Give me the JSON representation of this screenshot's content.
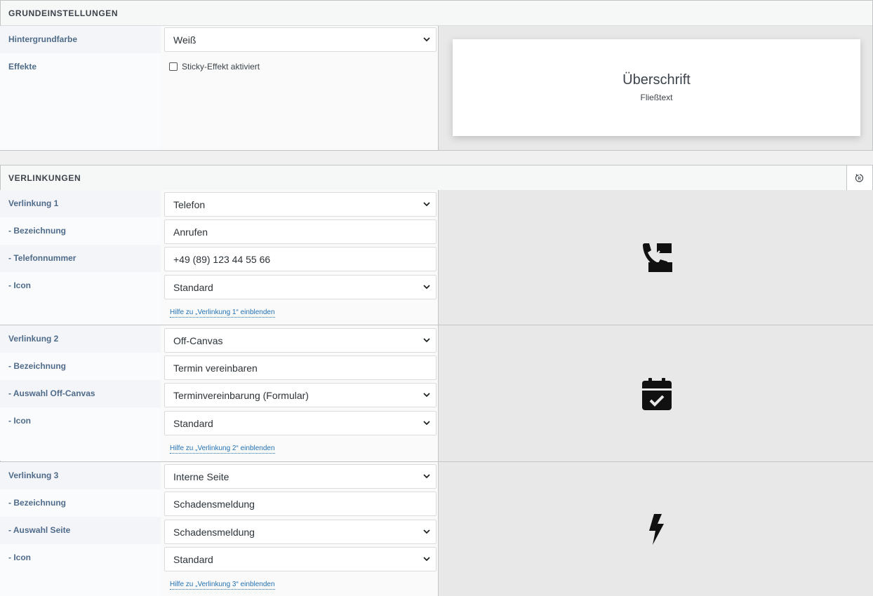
{
  "grundeinstellungen": {
    "title": "GRUNDEINSTELLUNGEN",
    "hintergrundfarbe_label": "Hintergrundfarbe",
    "hintergrundfarbe_value": "Weiß",
    "effekte_label": "Effekte",
    "sticky_label": "Sticky-Effekt aktiviert",
    "sticky_checked": false,
    "preview_heading": "Überschrift",
    "preview_text": "Fließtext"
  },
  "verlinkungen": {
    "title": "VERLINKUNGEN",
    "reset_icon": "reset-icon",
    "items": [
      {
        "label": "Verlinkung 1",
        "type": "Telefon",
        "fields": [
          {
            "label": "- Bezeichnung",
            "value": "Anrufen",
            "kind": "input"
          },
          {
            "label": "- Telefonnummer",
            "value": "+49 (89) 123 44 55 66",
            "kind": "input"
          },
          {
            "label": "- Icon",
            "value": "Standard",
            "kind": "select"
          }
        ],
        "help": "Hilfe zu „Verlinkung 1“ einblenden",
        "icon": "phone-icon"
      },
      {
        "label": "Verlinkung 2",
        "type": "Off-Canvas",
        "fields": [
          {
            "label": "- Bezeichnung",
            "value": "Termin vereinbaren",
            "kind": "input"
          },
          {
            "label": "- Auswahl Off-Canvas",
            "value": "Terminvereinbarung (Formular)",
            "kind": "select"
          },
          {
            "label": "- Icon",
            "value": "Standard",
            "kind": "select"
          }
        ],
        "help": "Hilfe zu „Verlinkung 2“ einblenden",
        "icon": "calendar-check-icon"
      },
      {
        "label": "Verlinkung 3",
        "type": "Interne Seite",
        "fields": [
          {
            "label": "- Bezeichnung",
            "value": "Schadensmeldung",
            "kind": "input"
          },
          {
            "label": "- Auswahl Seite",
            "value": "Schadensmeldung",
            "kind": "select"
          },
          {
            "label": "- Icon",
            "value": "Standard",
            "kind": "select"
          }
        ],
        "help": "Hilfe zu „Verlinkung 3“ einblenden",
        "icon": "bolt-icon"
      }
    ]
  }
}
